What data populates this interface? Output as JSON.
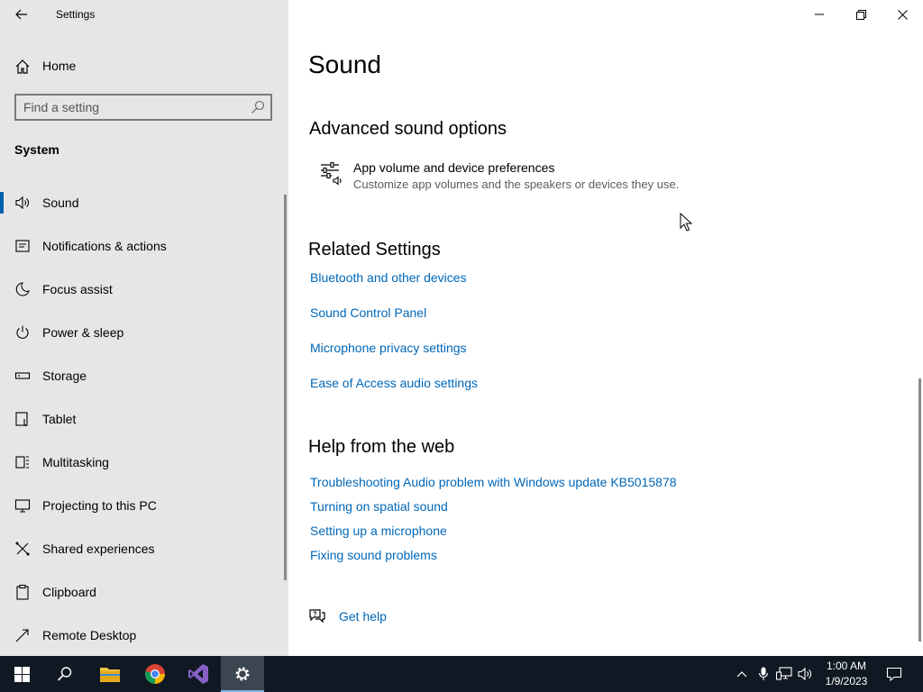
{
  "window": {
    "title": "Settings",
    "controls": [
      "minimize-icon",
      "restore-icon",
      "close-icon"
    ]
  },
  "sidebar": {
    "home_label": "Home",
    "search_placeholder": "Find a setting",
    "section_title": "System",
    "items": [
      {
        "label": "Sound",
        "icon": "speaker-icon",
        "active": true
      },
      {
        "label": "Notifications & actions",
        "icon": "notification-icon"
      },
      {
        "label": "Focus assist",
        "icon": "moon-icon"
      },
      {
        "label": "Power & sleep",
        "icon": "power-icon"
      },
      {
        "label": "Storage",
        "icon": "storage-icon"
      },
      {
        "label": "Tablet",
        "icon": "tablet-icon"
      },
      {
        "label": "Multitasking",
        "icon": "multitasking-icon"
      },
      {
        "label": "Projecting to this PC",
        "icon": "projecting-icon"
      },
      {
        "label": "Shared experiences",
        "icon": "shared-icon"
      },
      {
        "label": "Clipboard",
        "icon": "clipboard-icon"
      },
      {
        "label": "Remote Desktop",
        "icon": "remote-desktop-icon"
      }
    ]
  },
  "main": {
    "page_title": "Sound",
    "advanced": {
      "heading": "Advanced sound options",
      "pref_title": "App volume and device preferences",
      "pref_desc": "Customize app volumes and the speakers or devices they use."
    },
    "related": {
      "heading": "Related Settings",
      "links": [
        "Bluetooth and other devices",
        "Sound Control Panel",
        "Microphone privacy settings",
        "Ease of Access audio settings"
      ]
    },
    "help": {
      "heading": "Help from the web",
      "links": [
        "Troubleshooting Audio problem with Windows update KB5015878",
        "Turning on spatial sound",
        "Setting up a microphone",
        "Fixing sound problems"
      ]
    },
    "get_help": "Get help"
  },
  "taskbar": {
    "apps": [
      "windows-start-icon",
      "search-icon",
      "file-explorer-icon",
      "chrome-icon",
      "visual-studio-icon",
      "settings-gear-icon"
    ],
    "active_app": "settings-gear-icon",
    "time": "1:00 AM",
    "date": "1/9/2023"
  },
  "colors": {
    "sidebar_bg": "#e6e6e6",
    "accent": "#0063b1",
    "link": "#0067b8",
    "taskbar_bg": "#101923"
  }
}
